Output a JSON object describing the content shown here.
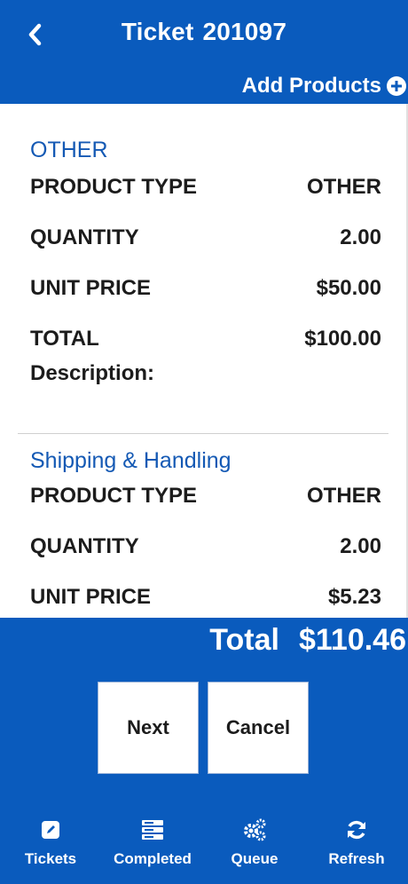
{
  "header": {
    "title_label": "Ticket",
    "ticket_number": "201097",
    "add_products_label": "Add Products"
  },
  "items": [
    {
      "name": "OTHER",
      "product_type_label": "PRODUCT TYPE",
      "product_type_value": "OTHER",
      "quantity_label": "QUANTITY",
      "quantity_value": "2.00",
      "unit_price_label": "UNIT PRICE",
      "unit_price_value": "$50.00",
      "total_label": "TOTAL",
      "total_value": "$100.00",
      "description_label": "Description:"
    },
    {
      "name": "Shipping & Handling",
      "product_type_label": "PRODUCT TYPE",
      "product_type_value": "OTHER",
      "quantity_label": "QUANTITY",
      "quantity_value": "2.00",
      "unit_price_label": "UNIT PRICE",
      "unit_price_value": "$5.23"
    }
  ],
  "footer": {
    "total_label": "Total",
    "total_value": "$110.46",
    "next_label": "Next",
    "cancel_label": "Cancel"
  },
  "nav": [
    {
      "label": "Tickets",
      "icon": "edit-icon"
    },
    {
      "label": "Completed",
      "icon": "list-icon"
    },
    {
      "label": "Queue",
      "icon": "gears-icon"
    },
    {
      "label": "Refresh",
      "icon": "refresh-icon"
    }
  ],
  "colors": {
    "primary": "#0a5bbd",
    "section_title": "#1459b4",
    "text": "#1c1c1c"
  }
}
